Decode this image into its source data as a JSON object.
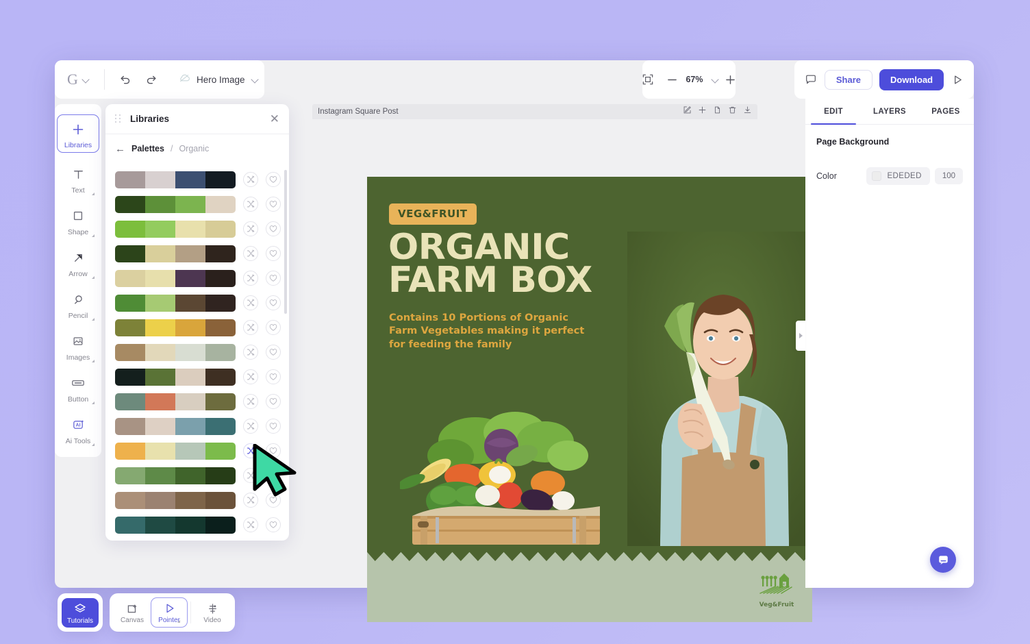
{
  "app": {
    "logo": "G",
    "document_name": "Hero Image",
    "zoom_level": "67%",
    "share_label": "Share",
    "download_label": "Download"
  },
  "left_rail": {
    "items": [
      {
        "label": "Libraries",
        "icon": "plus-icon",
        "active": true
      },
      {
        "label": "Text",
        "icon": "text-icon",
        "active": false
      },
      {
        "label": "Shape",
        "icon": "square-icon",
        "active": false
      },
      {
        "label": "Arrow",
        "icon": "arrow-icon",
        "active": false
      },
      {
        "label": "Pencil",
        "icon": "pencil-icon",
        "active": false
      },
      {
        "label": "Images",
        "icon": "image-icon",
        "active": false
      },
      {
        "label": "Button",
        "icon": "button-icon",
        "active": false
      },
      {
        "label": "Ai Tools",
        "icon": "ai-icon",
        "active": false
      }
    ]
  },
  "libraries_panel": {
    "title": "Libraries",
    "close_icon": "close-icon",
    "breadcrumb": {
      "root": "Palettes",
      "separator": "/",
      "current": "Organic"
    },
    "palettes": [
      {
        "id": 1,
        "colors": [
          "#a79a9a",
          "#d8d0d0",
          "#3c4f71",
          "#131b22"
        ],
        "selected": false
      },
      {
        "id": 2,
        "colors": [
          "#2c461a",
          "#5d9039",
          "#7cb44f",
          "#e0d3c2"
        ],
        "selected": false
      },
      {
        "id": 3,
        "colors": [
          "#7cbe3c",
          "#93cc5e",
          "#e8e0ac",
          "#d7cc97"
        ],
        "selected": false
      },
      {
        "id": 4,
        "colors": [
          "#2c441a",
          "#d9cf9b",
          "#b39f85",
          "#2f241d"
        ],
        "selected": false
      },
      {
        "id": 5,
        "colors": [
          "#dbd0a0",
          "#e7dfac",
          "#4d3651",
          "#2a201c"
        ],
        "selected": false
      },
      {
        "id": 6,
        "colors": [
          "#4f8c36",
          "#a6ca73",
          "#5b4733",
          "#302420"
        ],
        "selected": false
      },
      {
        "id": 7,
        "colors": [
          "#7d8238",
          "#ecd04a",
          "#d9a53b",
          "#8a6239"
        ],
        "selected": false
      },
      {
        "id": 8,
        "colors": [
          "#a78a63",
          "#e2d8ba",
          "#d8ddd2",
          "#a7b3a0",
          "#ffffff"
        ],
        "selected": false
      },
      {
        "id": 9,
        "colors": [
          "#141f1d",
          "#5a7336",
          "#dbcdbe",
          "#3e2f22"
        ],
        "selected": false
      },
      {
        "id": 10,
        "colors": [
          "#6d8a7c",
          "#d27858",
          "#d8cec0",
          "#6d6c3e"
        ],
        "selected": false
      },
      {
        "id": 11,
        "colors": [
          "#a89384",
          "#ded0c4",
          "#7ba0ac",
          "#3b6f73"
        ],
        "selected": false
      },
      {
        "id": 12,
        "colors": [
          "#eeb14c",
          "#e8e1ad",
          "#b6c7b8",
          "#7cbb4b"
        ],
        "selected": true
      },
      {
        "id": 13,
        "colors": [
          "#85a971",
          "#5e8a48",
          "#40642b",
          "#263d17"
        ],
        "selected": false
      },
      {
        "id": 14,
        "colors": [
          "#ab8f78",
          "#9b8271",
          "#7e6449",
          "#6b523a"
        ],
        "selected": false
      },
      {
        "id": 15,
        "colors": [
          "#356a6a",
          "#1f4a43",
          "#14382f",
          "#0b1f1c"
        ],
        "selected": false
      }
    ],
    "row_actions": {
      "shuffle_icon": "shuffle-icon",
      "favorite_icon": "heart-icon"
    }
  },
  "canvas": {
    "page_label": "Instagram Square Post",
    "page_actions": [
      "edit-icon",
      "plus-icon",
      "duplicate-icon",
      "trash-icon",
      "download-icon"
    ],
    "design": {
      "background_color": "#4d6430",
      "badge": "VEG&FRUIT",
      "headline_line1": "ORGANIC",
      "headline_line2": "FARM BOX",
      "subcopy": "Contains 10 Portions of Organic Farm Vegetables making it perfect for feeding the family",
      "band_color": "#b6c4ab",
      "logo_text": "Veg&Fruit",
      "headline_color": "#e9e3b8",
      "subcopy_color": "#dda63f",
      "badge_color": "#e8b359"
    }
  },
  "right_panel": {
    "tabs": [
      {
        "label": "EDIT",
        "active": true
      },
      {
        "label": "LAYERS",
        "active": false
      },
      {
        "label": "PAGES",
        "active": false
      }
    ],
    "section_title": "Page Background",
    "color_row_label": "Color",
    "color_value": "EDEDED",
    "opacity_value": "100"
  },
  "bottom_bar": {
    "primary": {
      "label": "Tutorials",
      "icon": "layers-icon"
    },
    "items": [
      {
        "label": "Canvas",
        "icon": "canvas-icon",
        "selected": false
      },
      {
        "label": "Pointer",
        "icon": "pointer-icon",
        "selected": true
      },
      {
        "label": "Video",
        "icon": "video-icon",
        "selected": false
      }
    ]
  },
  "chat": {
    "icon": "chat-bubble-icon"
  },
  "collapse_handle": {
    "icon": "chevron-right-icon"
  }
}
